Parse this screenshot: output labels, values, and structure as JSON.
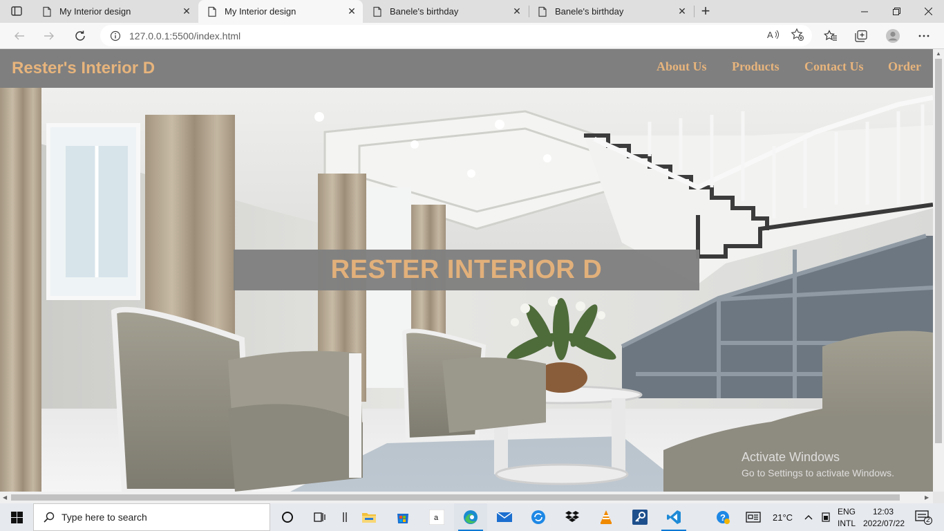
{
  "tabs": [
    {
      "title": "My Interior design",
      "active": false
    },
    {
      "title": "My Interior design",
      "active": true
    },
    {
      "title": "Banele's birthday",
      "active": false
    },
    {
      "title": "Banele's birthday",
      "active": false
    }
  ],
  "address": {
    "url": "127.0.0.1:5500/index.html"
  },
  "site": {
    "brand": "Rester's Interior D",
    "nav": [
      "About Us",
      "Products",
      "Contact Us",
      "Order"
    ],
    "banner": "RESTER INTERIOR D",
    "accent": "#e7b47c",
    "nav_bg": "#7f7f7f"
  },
  "watermark": {
    "line1": "Activate Windows",
    "line2": "Go to Settings to activate Windows."
  },
  "taskbar": {
    "search_placeholder": "Type here to search",
    "temperature": "21°C",
    "lang1": "ENG",
    "lang2": "INTL",
    "time": "12:03",
    "date": "2022/07/22",
    "notifications": "2"
  }
}
